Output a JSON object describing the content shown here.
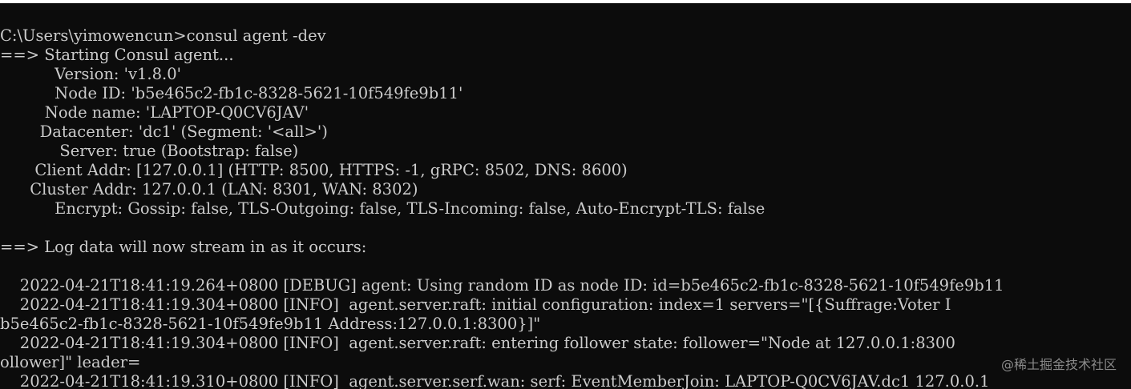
{
  "terminal": {
    "lines": [
      "C:\\Users\\yimowencun>consul agent -dev",
      "==> Starting Consul agent...",
      "           Version: 'v1.8.0'",
      "           Node ID: 'b5e465c2-fb1c-8328-5621-10f549fe9b11'",
      "         Node name: 'LAPTOP-Q0CV6JAV'",
      "        Datacenter: 'dc1' (Segment: '<all>')",
      "            Server: true (Bootstrap: false)",
      "       Client Addr: [127.0.0.1] (HTTP: 8500, HTTPS: -1, gRPC: 8502, DNS: 8600)",
      "      Cluster Addr: 127.0.0.1 (LAN: 8301, WAN: 8302)",
      "           Encrypt: Gossip: false, TLS-Outgoing: false, TLS-Incoming: false, Auto-Encrypt-TLS: false",
      "",
      "==> Log data will now stream in as it occurs:",
      "",
      "    2022-04-21T18:41:19.264+0800 [DEBUG] agent: Using random ID as node ID: id=b5e465c2-fb1c-8328-5621-10f549fe9b11",
      "    2022-04-21T18:41:19.304+0800 [INFO]  agent.server.raft: initial configuration: index=1 servers=\"[{Suffrage:Voter I",
      "b5e465c2-fb1c-8328-5621-10f549fe9b11 Address:127.0.0.1:8300}]\"",
      "    2022-04-21T18:41:19.304+0800 [INFO]  agent.server.raft: entering follower state: follower=\"Node at 127.0.0.1:8300",
      "ollower]\" leader=",
      "    2022-04-21T18:41:19.310+0800 [INFO]  agent.server.serf.wan: serf: EventMemberJoin: LAPTOP-Q0CV6JAV.dc1 127.0.0.1"
    ]
  },
  "watermark": "@稀土掘金技术社区"
}
